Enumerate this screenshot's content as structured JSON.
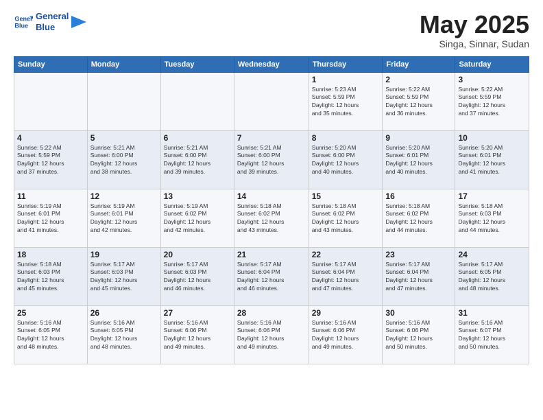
{
  "logo": {
    "text_general": "General",
    "text_blue": "Blue"
  },
  "header": {
    "month": "May 2025",
    "location": "Singa, Sinnar, Sudan"
  },
  "weekdays": [
    "Sunday",
    "Monday",
    "Tuesday",
    "Wednesday",
    "Thursday",
    "Friday",
    "Saturday"
  ],
  "weeks": [
    [
      {
        "day": "",
        "info": ""
      },
      {
        "day": "",
        "info": ""
      },
      {
        "day": "",
        "info": ""
      },
      {
        "day": "",
        "info": ""
      },
      {
        "day": "1",
        "info": "Sunrise: 5:23 AM\nSunset: 5:59 PM\nDaylight: 12 hours\nand 35 minutes."
      },
      {
        "day": "2",
        "info": "Sunrise: 5:22 AM\nSunset: 5:59 PM\nDaylight: 12 hours\nand 36 minutes."
      },
      {
        "day": "3",
        "info": "Sunrise: 5:22 AM\nSunset: 5:59 PM\nDaylight: 12 hours\nand 37 minutes."
      }
    ],
    [
      {
        "day": "4",
        "info": "Sunrise: 5:22 AM\nSunset: 5:59 PM\nDaylight: 12 hours\nand 37 minutes."
      },
      {
        "day": "5",
        "info": "Sunrise: 5:21 AM\nSunset: 6:00 PM\nDaylight: 12 hours\nand 38 minutes."
      },
      {
        "day": "6",
        "info": "Sunrise: 5:21 AM\nSunset: 6:00 PM\nDaylight: 12 hours\nand 39 minutes."
      },
      {
        "day": "7",
        "info": "Sunrise: 5:21 AM\nSunset: 6:00 PM\nDaylight: 12 hours\nand 39 minutes."
      },
      {
        "day": "8",
        "info": "Sunrise: 5:20 AM\nSunset: 6:00 PM\nDaylight: 12 hours\nand 40 minutes."
      },
      {
        "day": "9",
        "info": "Sunrise: 5:20 AM\nSunset: 6:01 PM\nDaylight: 12 hours\nand 40 minutes."
      },
      {
        "day": "10",
        "info": "Sunrise: 5:20 AM\nSunset: 6:01 PM\nDaylight: 12 hours\nand 41 minutes."
      }
    ],
    [
      {
        "day": "11",
        "info": "Sunrise: 5:19 AM\nSunset: 6:01 PM\nDaylight: 12 hours\nand 41 minutes."
      },
      {
        "day": "12",
        "info": "Sunrise: 5:19 AM\nSunset: 6:01 PM\nDaylight: 12 hours\nand 42 minutes."
      },
      {
        "day": "13",
        "info": "Sunrise: 5:19 AM\nSunset: 6:02 PM\nDaylight: 12 hours\nand 42 minutes."
      },
      {
        "day": "14",
        "info": "Sunrise: 5:18 AM\nSunset: 6:02 PM\nDaylight: 12 hours\nand 43 minutes."
      },
      {
        "day": "15",
        "info": "Sunrise: 5:18 AM\nSunset: 6:02 PM\nDaylight: 12 hours\nand 43 minutes."
      },
      {
        "day": "16",
        "info": "Sunrise: 5:18 AM\nSunset: 6:02 PM\nDaylight: 12 hours\nand 44 minutes."
      },
      {
        "day": "17",
        "info": "Sunrise: 5:18 AM\nSunset: 6:03 PM\nDaylight: 12 hours\nand 44 minutes."
      }
    ],
    [
      {
        "day": "18",
        "info": "Sunrise: 5:18 AM\nSunset: 6:03 PM\nDaylight: 12 hours\nand 45 minutes."
      },
      {
        "day": "19",
        "info": "Sunrise: 5:17 AM\nSunset: 6:03 PM\nDaylight: 12 hours\nand 45 minutes."
      },
      {
        "day": "20",
        "info": "Sunrise: 5:17 AM\nSunset: 6:03 PM\nDaylight: 12 hours\nand 46 minutes."
      },
      {
        "day": "21",
        "info": "Sunrise: 5:17 AM\nSunset: 6:04 PM\nDaylight: 12 hours\nand 46 minutes."
      },
      {
        "day": "22",
        "info": "Sunrise: 5:17 AM\nSunset: 6:04 PM\nDaylight: 12 hours\nand 47 minutes."
      },
      {
        "day": "23",
        "info": "Sunrise: 5:17 AM\nSunset: 6:04 PM\nDaylight: 12 hours\nand 47 minutes."
      },
      {
        "day": "24",
        "info": "Sunrise: 5:17 AM\nSunset: 6:05 PM\nDaylight: 12 hours\nand 48 minutes."
      }
    ],
    [
      {
        "day": "25",
        "info": "Sunrise: 5:16 AM\nSunset: 6:05 PM\nDaylight: 12 hours\nand 48 minutes."
      },
      {
        "day": "26",
        "info": "Sunrise: 5:16 AM\nSunset: 6:05 PM\nDaylight: 12 hours\nand 48 minutes."
      },
      {
        "day": "27",
        "info": "Sunrise: 5:16 AM\nSunset: 6:06 PM\nDaylight: 12 hours\nand 49 minutes."
      },
      {
        "day": "28",
        "info": "Sunrise: 5:16 AM\nSunset: 6:06 PM\nDaylight: 12 hours\nand 49 minutes."
      },
      {
        "day": "29",
        "info": "Sunrise: 5:16 AM\nSunset: 6:06 PM\nDaylight: 12 hours\nand 49 minutes."
      },
      {
        "day": "30",
        "info": "Sunrise: 5:16 AM\nSunset: 6:06 PM\nDaylight: 12 hours\nand 50 minutes."
      },
      {
        "day": "31",
        "info": "Sunrise: 5:16 AM\nSunset: 6:07 PM\nDaylight: 12 hours\nand 50 minutes."
      }
    ]
  ]
}
